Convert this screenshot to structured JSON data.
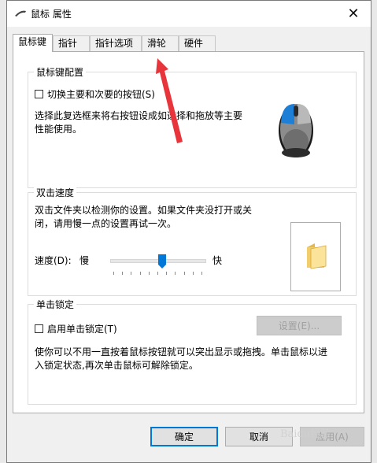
{
  "window": {
    "title": "鼠标 属性",
    "close_glyph": "✕"
  },
  "tabs": [
    {
      "label": "鼠标键",
      "active": true
    },
    {
      "label": "指针",
      "active": false
    },
    {
      "label": "指针选项",
      "active": false
    },
    {
      "label": "滑轮",
      "active": false
    },
    {
      "label": "硬件",
      "active": false
    }
  ],
  "button_config": {
    "legend": "鼠标键配置",
    "switch_checkbox_label": "切换主要和次要的按钮(S)",
    "switch_checked": false,
    "description_line1": "选择此复选框来将右按钮设成如选择和拖放等主要",
    "description_line2": "性能使用。"
  },
  "double_click": {
    "legend": "双击速度",
    "description_line1": "双击文件夹以检测你的设置。如果文件夹没打开或关",
    "description_line2": "闭，请用慢一点的设置再试一次。",
    "speed_label": "速度(D):",
    "slow_label": "慢",
    "fast_label": "快",
    "speed_value_fraction": 0.55
  },
  "click_lock": {
    "legend": "单击锁定",
    "checkbox_label": "启用单击锁定(T)",
    "checked": false,
    "settings_button": "设置(E)...",
    "description_line1": "使你可以不用一直按着鼠标按钮就可以突出显示或拖拽。单击鼠标以进",
    "description_line2": "入锁定状态,再次单击鼠标可解除锁定。"
  },
  "footer": {
    "ok_label": "确定",
    "cancel_label": "取消",
    "apply_label": "应用(A)"
  },
  "watermark": "Baidu经验",
  "colors": {
    "annotation_arrow": "#e8343b",
    "mouse_button_highlight": "#1e7fd6",
    "default_button_border": "#0078d7"
  }
}
